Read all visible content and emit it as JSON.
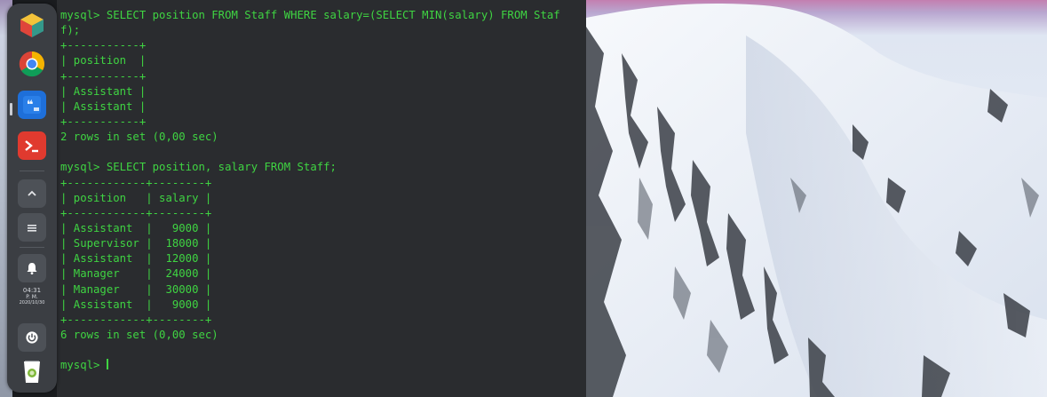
{
  "terminal": {
    "lines": [
      "mysql> SELECT position FROM Staff WHERE salary=(SELECT MIN(salary) FROM Staf",
      "f);",
      "+-----------+",
      "| position  |",
      "+-----------+",
      "| Assistant |",
      "| Assistant |",
      "+-----------+",
      "2 rows in set (0,00 sec)",
      "",
      "mysql> SELECT position, salary FROM Staff;",
      "+------------+--------+",
      "| position   | salary |",
      "+------------+--------+",
      "| Assistant  |   9000 |",
      "| Supervisor |  18000 |",
      "| Assistant  |  12000 |",
      "| Manager    |  24000 |",
      "| Manager    |  30000 |",
      "| Assistant  |   9000 |",
      "+------------+--------+",
      "6 rows in set (0,00 sec)",
      "",
      "mysql> "
    ],
    "text_color": "#3fd442",
    "background": "#2a2c2f"
  },
  "dock": {
    "items": [
      {
        "name": "app-center",
        "icon": "cube-icon"
      },
      {
        "name": "chrome",
        "icon": "chrome-icon"
      },
      {
        "name": "notes",
        "icon": "quote-icon"
      },
      {
        "name": "terminal",
        "icon": "terminal-icon"
      },
      {
        "name": "expand",
        "icon": "chevron-up-icon"
      },
      {
        "name": "menu",
        "icon": "menu-icon"
      },
      {
        "name": "notifications",
        "icon": "bell-icon"
      },
      {
        "name": "power",
        "icon": "power-icon"
      },
      {
        "name": "trash",
        "icon": "trash-icon"
      }
    ],
    "clock": {
      "time": "04:31",
      "period": "P. M.",
      "date": "2020/10/30"
    }
  }
}
